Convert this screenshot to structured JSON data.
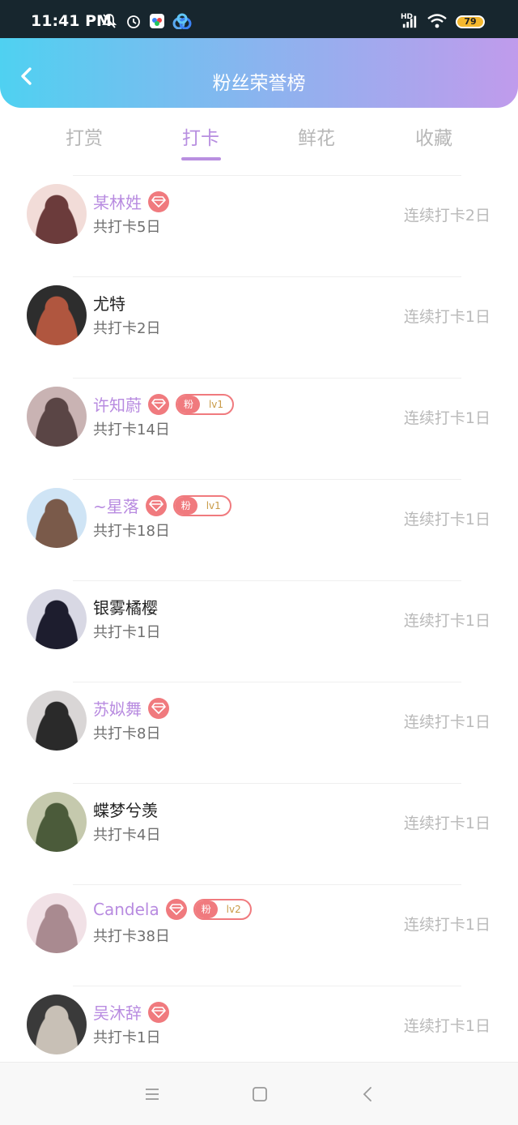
{
  "status_bar": {
    "time": "11:41 PM",
    "battery": "79",
    "network": "HD",
    "icons": [
      "mute-bell-icon",
      "alarm-icon",
      "app-icon",
      "cloud-app-icon",
      "signal-icon",
      "wifi-icon",
      "battery-icon"
    ]
  },
  "header": {
    "title": "粉丝荣誉榜",
    "back_icon": "chevron-left-icon"
  },
  "tabs": [
    {
      "label": "打赏",
      "active": false
    },
    {
      "label": "打卡",
      "active": true
    },
    {
      "label": "鲜花",
      "active": false
    },
    {
      "label": "收藏",
      "active": false
    }
  ],
  "fans": [
    {
      "name": "某林姓",
      "vip": true,
      "fan_char": "",
      "fan_level": "",
      "total": "共打卡5日",
      "streak": "连续打卡2日"
    },
    {
      "name": "尤特",
      "vip": false,
      "fan_char": "",
      "fan_level": "",
      "total": "共打卡2日",
      "streak": "连续打卡1日"
    },
    {
      "name": "许知蔚",
      "vip": true,
      "fan_char": "粉",
      "fan_level": "lv1",
      "total": "共打卡14日",
      "streak": "连续打卡1日"
    },
    {
      "name": "~星落",
      "vip": true,
      "fan_char": "粉",
      "fan_level": "lv1",
      "total": "共打卡18日",
      "streak": "连续打卡1日"
    },
    {
      "name": "银雾橘樱",
      "vip": false,
      "fan_char": "",
      "fan_level": "",
      "total": "共打卡1日",
      "streak": "连续打卡1日"
    },
    {
      "name": "苏姒舞",
      "vip": true,
      "fan_char": "",
      "fan_level": "",
      "total": "共打卡8日",
      "streak": "连续打卡1日"
    },
    {
      "name": "蝶梦兮羡",
      "vip": false,
      "fan_char": "",
      "fan_level": "",
      "total": "共打卡4日",
      "streak": "连续打卡1日"
    },
    {
      "name": "Candela",
      "vip": true,
      "fan_char": "粉",
      "fan_level": "lv2",
      "total": "共打卡38日",
      "streak": "连续打卡1日"
    },
    {
      "name": "吴沐辞",
      "vip": true,
      "fan_char": "",
      "fan_level": "",
      "total": "共打卡1日",
      "streak": "连续打卡1日"
    }
  ],
  "nav_bar": {
    "buttons": [
      "menu-icon",
      "home-square-icon",
      "back-triangle-icon"
    ]
  },
  "colors": {
    "accent": "#b98fe0",
    "badge": "#f07a7e",
    "header_gradient": [
      "#4fd1f1",
      "#c09bec"
    ]
  }
}
